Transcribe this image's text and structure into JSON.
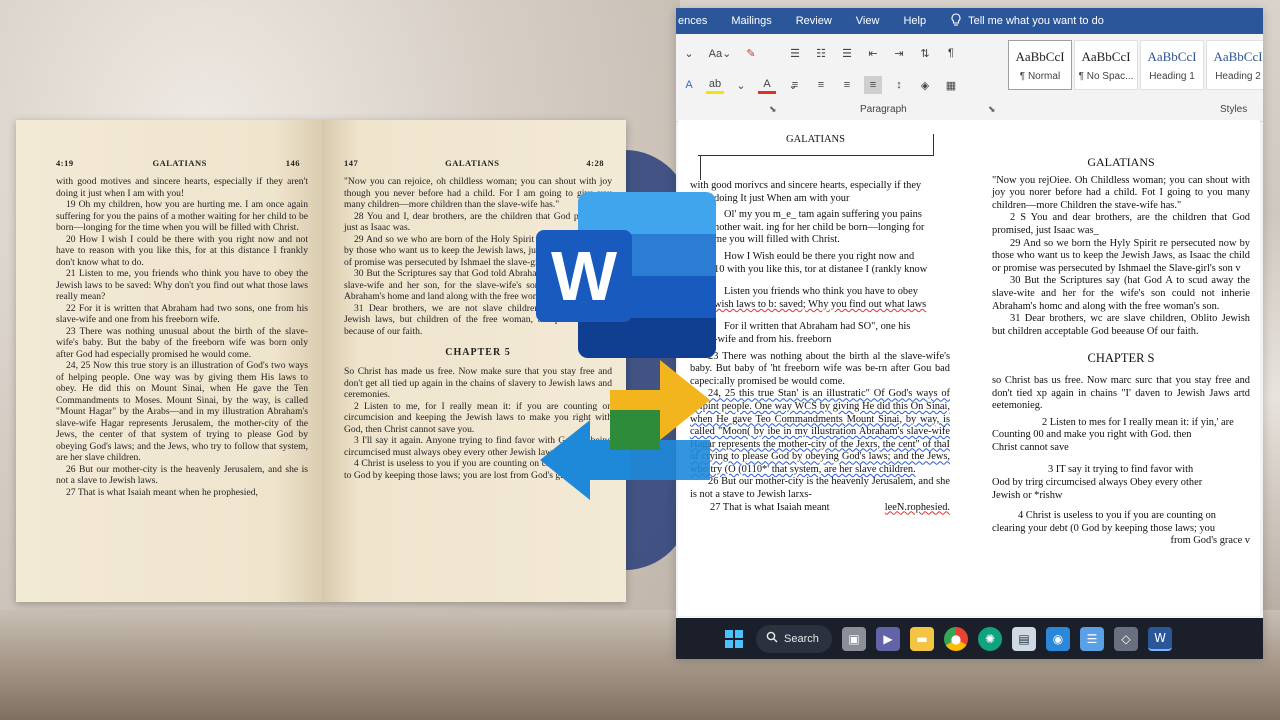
{
  "word_menu": {
    "tabs": [
      "ences",
      "Mailings",
      "Review",
      "View",
      "Help"
    ],
    "tell_me": "Tell me what you want to do"
  },
  "ribbon": {
    "paragraph_label": "Paragraph",
    "styles_label": "Styles",
    "styles": [
      {
        "sample": "AaBbCcI",
        "name": "¶ Normal"
      },
      {
        "sample": "AaBbCcI",
        "name": "¶ No Spac..."
      },
      {
        "sample": "AaBbCcI",
        "name": "Heading 1"
      },
      {
        "sample": "AaBbCcI",
        "name": "Heading 2"
      }
    ]
  },
  "doc": {
    "header_box": "GALATIANS",
    "left_col": [
      "with good morivcs and sincere hearts, especially if they",
      "doing It just When am with your",
      "Ol' my you m_e_ tam again suffering you pains",
      "nother wait. ing for her child be born—longing for",
      "me you will filled with Christ.",
      "How I Wish eould be there you right now and",
      "10 with you like this, tor at distanee I (rankly know",
      "Listen you friends who think you have to obey",
      "wish laws to b: saved; Why you find out what laws",
      "For il written that Abraham had SO\", one his",
      "-wife and from his. freeborn",
      "23 There was nothing about the birth al the slave-wife's baby. But baby of 'ht freeborn wife was be-rn after Gou bad capeci:ally promised be would come.",
      "24, 25 this true Stan' is an illustratic\" Of God's ways of helpint people. One way WCS by giving He did this On Sinai, when He gave Teo Commandments Mount Sinai, by way, is called \"Moon( by ibe in my illustration Abraham's slave-wife Hagar represents the mother-city of the Jexrs, the cent\" of thaI of crying to please God by obeying God's laws; and the Jews, who try (O (0110*' that system, are her slave children.",
      "26 But our mother-city is the heavenly Jerusalem, and she is not a stave to Jewish larxs-",
      "27 That is what Isaiah meant",
      "leeN.rophesied."
    ],
    "right_title": "GALATIANS",
    "right_col": [
      "\"Now you rejOiee. Oh Childless woman; you can shout with joy you norer before had a child. Fot I going to you many children—more Children the stave-wife has.\"",
      "2 S You and dear brothers, are the children that God promised, just Isaac was_",
      "29 And so we born the Hyly Spirit re persecuted now by those who want us to keep the Jewish Jaws, as Isaac the child or promise was persecuted by Ishmael the Slave-girl's son v",
      "30 But the Scriptures say (hat God A to scud away the slave-wite and her for the wife's son could not inherie Abraham's homc and along with the free woman's son.",
      "31 Dear brothers, wc are slave children, Oblito Jewish but children acceptable God beeause Of our faith."
    ],
    "chapter_title": "CHAPTER S",
    "right_col_2": [
      "so Christ bas us free. Now marc surc that you stay free and don't tied xp again in chains \"I' daven to Jewish Jaws artd eetemonieg.",
      "2 Listen to mes for I really mean it: if yin,' are",
      "Counting 00 and make you right with God. then",
      "Christ cannot save",
      "3 IT say it trying to find favor with",
      "Ood by trirg circumcised always Obey every other",
      "Jewish or *rishw",
      "4 Christ is useless to you if you are counting on",
      "clearing your debt (0 God by keeping those laws; you",
      "from God's grace v"
    ]
  },
  "book": {
    "left_page": {
      "verse_ref": "4:19",
      "title": "GALATIANS",
      "page_no": "146",
      "paragraphs": [
        "with good motives and sincere hearts, especially if they aren't doing it just when I am with you!",
        "19 Oh my children, how you are hurting me. I am once again suffering for you the pains of a mother waiting for her child to be born—longing for the time when you will be filled with Christ.",
        "20 How I wish I could be there with you right now and not have to reason with you like this, for at this distance I frankly don't know what to do.",
        "21 Listen to me, you friends who think you have to obey the Jewish laws to be saved: Why don't you find out what those laws really mean?",
        "22 For it is written that Abraham had two sons, one from his slave-wife and one from his freeborn wife.",
        "23 There was nothing unusual about the birth of the slave-wife's baby. But the baby of the freeborn wife was born only after God had especially promised he would come.",
        "24, 25 Now this true story is an illustration of God's two ways of helping people. One way was by giving them His laws to obey. He did this on Mount Sinai, when He gave the Ten Commandments to Moses. Mount Sinai, by the way, is called \"Mount Hagar\" by the Arabs—and in my illustration Abraham's slave-wife Hagar represents Jerusalem, the mother-city of the Jews, the center of that system of trying to please God by obeying God's laws; and the Jews, who try to follow that system, are her slave children.",
        "26 But our mother-city is the heavenly Jerusalem, and she is not a slave to Jewish laws.",
        "27 That is what Isaiah meant when he prophesied,"
      ]
    },
    "right_page": {
      "page_no": "147",
      "title": "GALATIANS",
      "verse_ref": "4:28",
      "paragraphs": [
        "\"Now you can rejoice, oh childless woman; you can shout with joy though you never before had a child. For I am going to give you many children—more children than the slave-wife has.\"",
        "28 You and I, dear brothers, are the children that God promised, just as Isaac was.",
        "29 And so we who are born of the Holy Spirit are persecuted now by those who want us to keep the Jewish laws, just as Isaac the child of promise was persecuted by Ishmael the slave-girl's son.",
        "30 But the Scriptures say that God told Abraham to send away the slave-wife and her son, for the slave-wife's son could not inherit Abraham's home and land along with the free woman's son.",
        "31 Dear brothers, we are not slave children, obligated to the Jewish laws, but children of the free woman, acceptable to God because of our faith."
      ],
      "chapter": "CHAPTER 5",
      "chapter_paragraphs": [
        "So Christ has made us free. Now make sure that you stay free and don't get all tied up again in the chains of slavery to Jewish laws and ceremonies.",
        "2 Listen to me, for I really mean it: if you are counting on circumcision and keeping the Jewish laws to make you right with God, then Christ cannot save you.",
        "3 I'll say it again. Anyone trying to find favor with God by being circumcised must always obey every other Jewish law or perish.",
        "4 Christ is useless to you if you are counting on clearing your debt to God by keeping those laws; you are lost from God's grace."
      ]
    }
  },
  "logo": {
    "letter": "W"
  },
  "taskbar": {
    "search_label": "Search"
  },
  "colors": {
    "word_blue": "#2b579a",
    "accent_yellow": "#f2b51d",
    "accent_green": "#2e8b3a",
    "accent_blue": "#1e88d9"
  }
}
